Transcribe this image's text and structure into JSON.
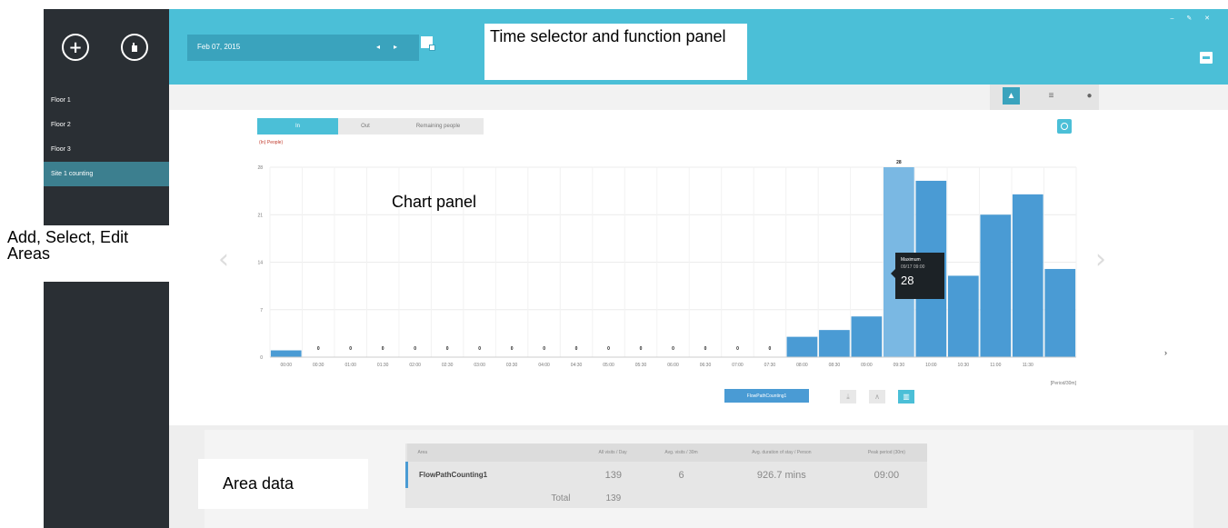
{
  "sidebar": {
    "add_label": "+",
    "items": [
      "Floor 1",
      "Floor 2",
      "Floor 3",
      "Site 1 counting"
    ]
  },
  "topbar": {
    "date": "Feb 07, 2015",
    "prev": "◂",
    "next": "▸",
    "window_controls": "– ✎ ✕"
  },
  "annotations": {
    "time_selector": "Time selector and function panel",
    "chart_panel": "Chart panel",
    "add_select_edit": "Add, Select, Edit Areas",
    "area_data": "Area data"
  },
  "chart_tabs": [
    "In",
    "Out",
    "Remaining people"
  ],
  "unit_label": "(In) People)",
  "legend_button": "FlowPathCounting1",
  "tooltip": {
    "title": "Maximum",
    "date": "09/17 09:00",
    "value": "28"
  },
  "chart_data": {
    "type": "bar",
    "categories": [
      "00:00",
      "00:30",
      "01:00",
      "01:30",
      "02:00",
      "02:30",
      "03:00",
      "03:30",
      "04:00",
      "04:30",
      "05:00",
      "05:30",
      "06:00",
      "06:30",
      "07:00",
      "07:30",
      "08:00",
      "08:30",
      "09:00",
      "09:30",
      "10:00",
      "10:30",
      "11:00",
      "11:30"
    ],
    "values": [
      1,
      0,
      0,
      0,
      0,
      0,
      0,
      0,
      0,
      0,
      0,
      0,
      0,
      0,
      0,
      0,
      3,
      4,
      6,
      28,
      26,
      12,
      21,
      24,
      13
    ],
    "ylim": [
      0,
      28
    ],
    "yticks": [
      "0",
      "7",
      "14",
      "21",
      "28"
    ],
    "highlight_index": 19,
    "highlight_label": "28",
    "xlabel": "[Period/30m]",
    "bar_color": "#4a9bd4",
    "highlight_color": "#7ab8e3"
  },
  "area_table": {
    "headers": [
      "Area",
      "All visits / Day",
      "Avg. visits / 30m",
      "Avg. duration of stay / Person",
      "Peak period (30m)"
    ],
    "rows": [
      {
        "name": "FlowPathCounting1",
        "visits": "139",
        "avg": "6",
        "duration": "926.7 mins",
        "peak": "09:00"
      }
    ],
    "total_label": "Total",
    "total_value": "139"
  },
  "colors": {
    "accent": "#4bbfd7",
    "sidebar": "#2a2f34",
    "bar": "#4a9bd4"
  }
}
